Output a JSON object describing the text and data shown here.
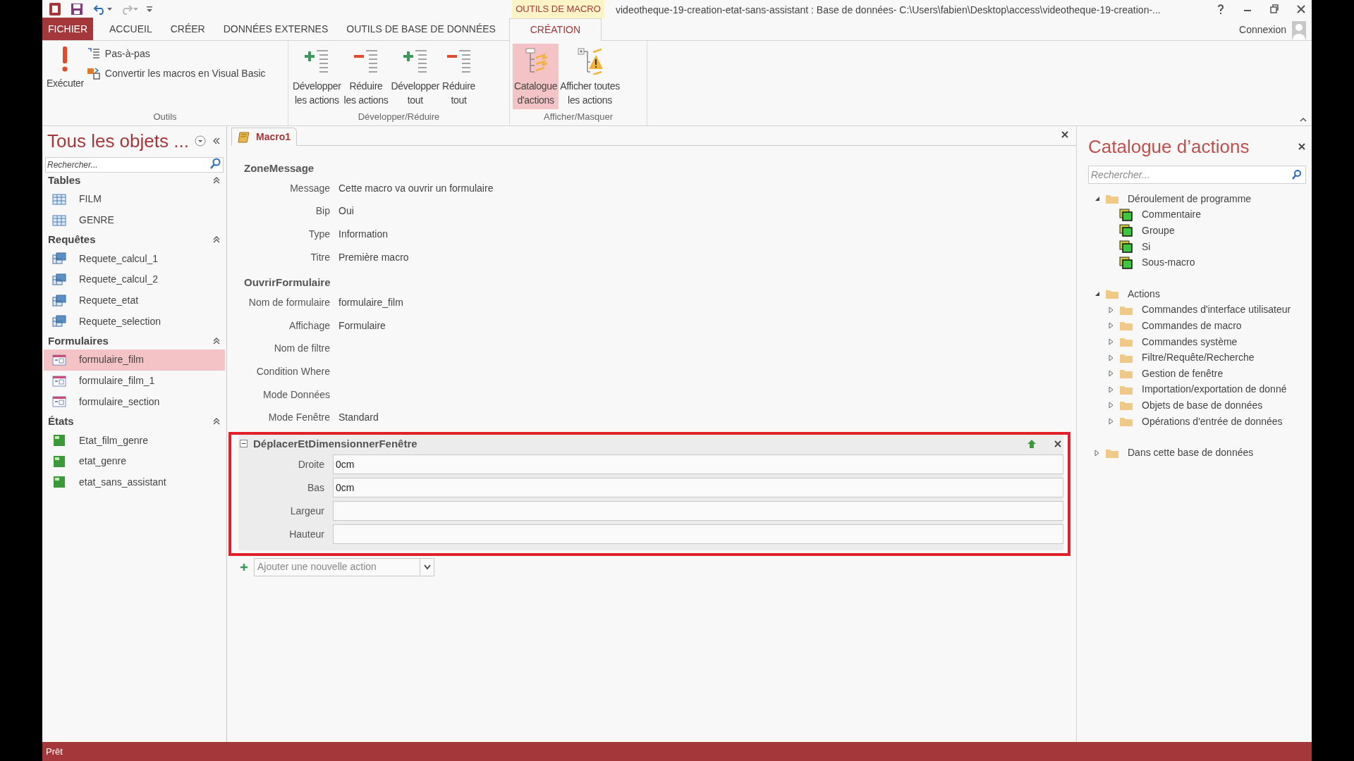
{
  "window": {
    "context_tab": "OUTILS DE MACRO",
    "title": "videotheque-19-creation-etat-sans-assistant : Base de données- C:\\Users\\fabien\\Desktop\\access\\videotheque-19-creation-...",
    "account": "Connexion"
  },
  "ribbon_tabs": [
    {
      "label": "FICHIER",
      "kind": "file",
      "selected": false
    },
    {
      "label": "ACCUEIL",
      "kind": "tab",
      "selected": false
    },
    {
      "label": "CRÉER",
      "kind": "tab",
      "selected": false
    },
    {
      "label": "DONNÉES EXTERNES",
      "kind": "tab",
      "selected": false
    },
    {
      "label": "OUTILS DE BASE DE DONNÉES",
      "kind": "tab",
      "selected": false
    },
    {
      "label": "CRÉATION",
      "kind": "tab",
      "selected": true
    }
  ],
  "ribbon_groups": [
    {
      "label": "Outils",
      "buttons": [
        {
          "kind": "run",
          "lines": [
            "Exécuter"
          ],
          "selected": false
        },
        {
          "kind": "step",
          "lines": [
            "Pas-à-pas"
          ],
          "selected": false
        },
        {
          "kind": "convert",
          "lines": [
            "Convertir les macros en Visual Basic"
          ],
          "selected": false
        }
      ]
    },
    {
      "label": "Développer/Réduire",
      "buttons": [
        {
          "kind": "expand",
          "lines": [
            "Développer",
            "les actions"
          ],
          "selected": false
        },
        {
          "kind": "collapse",
          "lines": [
            "Réduire",
            "les actions"
          ],
          "selected": false
        },
        {
          "kind": "expand",
          "lines": [
            "Développer",
            "tout"
          ],
          "selected": false
        },
        {
          "kind": "collapse",
          "lines": [
            "Réduire",
            "tout"
          ],
          "selected": false
        }
      ]
    },
    {
      "label": "Afficher/Masquer",
      "buttons": [
        {
          "kind": "catalog",
          "lines": [
            "Catalogue",
            "d'actions"
          ],
          "selected": true
        },
        {
          "kind": "show_all",
          "lines": [
            "Afficher toutes",
            "les actions"
          ],
          "selected": false
        }
      ]
    }
  ],
  "navigation": {
    "title": "Tous les objets ...",
    "search": {
      "placeholder": "Rechercher..."
    },
    "groups": [
      {
        "label": "Tables",
        "kind": "table",
        "items": [
          {
            "label": "FILM",
            "selected": false
          },
          {
            "label": "GENRE",
            "selected": false
          }
        ]
      },
      {
        "label": "Requêtes",
        "kind": "query",
        "items": [
          {
            "label": "Requete_calcul_1",
            "selected": false
          },
          {
            "label": "Requete_calcul_2",
            "selected": false
          },
          {
            "label": "Requete_etat",
            "selected": false
          },
          {
            "label": "Requete_selection",
            "selected": false
          }
        ]
      },
      {
        "label": "Formulaires",
        "kind": "form",
        "items": [
          {
            "label": "formulaire_film",
            "selected": true
          },
          {
            "label": "formulaire_film_1",
            "selected": false
          },
          {
            "label": "formulaire_section",
            "selected": false
          }
        ]
      },
      {
        "label": "États",
        "kind": "report",
        "items": [
          {
            "label": "Etat_film_genre",
            "selected": false
          },
          {
            "label": "etat_genre",
            "selected": false
          },
          {
            "label": "etat_sans_assistant",
            "selected": false
          }
        ]
      }
    ]
  },
  "macro": {
    "tab": "Macro1",
    "actions": [
      {
        "name": "ZoneMessage",
        "kind": "static",
        "highlighted": false,
        "args": [
          {
            "label": "Message",
            "value": "Cette macro va ouvrir un formulaire"
          },
          {
            "label": "Bip",
            "value": "Oui"
          },
          {
            "label": "Type",
            "value": "Information"
          },
          {
            "label": "Titre",
            "value": "Première macro"
          }
        ]
      },
      {
        "name": "OuvrirFormulaire",
        "kind": "static",
        "highlighted": false,
        "args": [
          {
            "label": "Nom de formulaire",
            "value": "formulaire_film"
          },
          {
            "label": "Affichage",
            "value": "Formulaire"
          },
          {
            "label": "Nom de filtre"
          },
          {
            "label": "Condition Where"
          },
          {
            "label": "Mode Données"
          },
          {
            "label": "Mode Fenêtre",
            "value": "Standard"
          }
        ]
      },
      {
        "name": "DéplacerEtDimensionnerFenêtre",
        "kind": "edit",
        "expanded": true,
        "highlighted": true,
        "args": [
          {
            "label": "Droite",
            "value": "0cm"
          },
          {
            "label": "Bas",
            "value": "0cm"
          },
          {
            "label": "Largeur"
          },
          {
            "label": "Hauteur"
          }
        ]
      }
    ],
    "add_action": {
      "placeholder": "Ajouter une nouvelle action"
    }
  },
  "catalog": {
    "title": "Catalogue d’actions",
    "search": {
      "placeholder": "Rechercher..."
    },
    "tree": [
      {
        "label": "Déroulement de programme",
        "kind": "folder",
        "expanded": true,
        "children": [
          {
            "label": "Commentaire",
            "kind": "block"
          },
          {
            "label": "Groupe",
            "kind": "block"
          },
          {
            "label": "Si",
            "kind": "block"
          },
          {
            "label": "Sous-macro",
            "kind": "block"
          }
        ]
      },
      {
        "label": "Actions",
        "kind": "folder",
        "expanded": true,
        "children": [
          {
            "label": "Commandes d'interface utilisateur",
            "kind": "folder",
            "expanded": false
          },
          {
            "label": "Commandes de macro",
            "kind": "folder",
            "expanded": false
          },
          {
            "label": "Commandes système",
            "kind": "folder",
            "expanded": false
          },
          {
            "label": "Filtre/Requête/Recherche",
            "kind": "folder",
            "expanded": false
          },
          {
            "label": "Gestion de fenêtre",
            "kind": "folder",
            "expanded": false
          },
          {
            "label": "Importation/exportation de donné",
            "kind": "folder",
            "expanded": false
          },
          {
            "label": "Objets de base de données",
            "kind": "folder",
            "expanded": false
          },
          {
            "label": "Opérations d'entrée de données",
            "kind": "folder",
            "expanded": false
          }
        ]
      },
      {
        "label": "Dans cette base de données",
        "kind": "folder",
        "expanded": false
      }
    ]
  },
  "status_bar": {
    "text": "Prêt"
  }
}
